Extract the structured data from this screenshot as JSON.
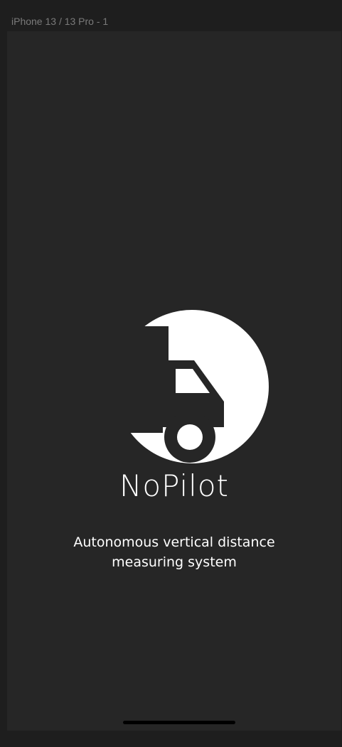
{
  "frame": {
    "label": "iPhone 13 / 13 Pro - 1"
  },
  "splash": {
    "logo_icon": "truck-moon-logo-icon",
    "brand_name": "NoPilot",
    "tagline_line1": "Autonomous vertical distance",
    "tagline_line2": "measuring system"
  },
  "colors": {
    "background": "#262626",
    "foreground": "#ffffff"
  }
}
